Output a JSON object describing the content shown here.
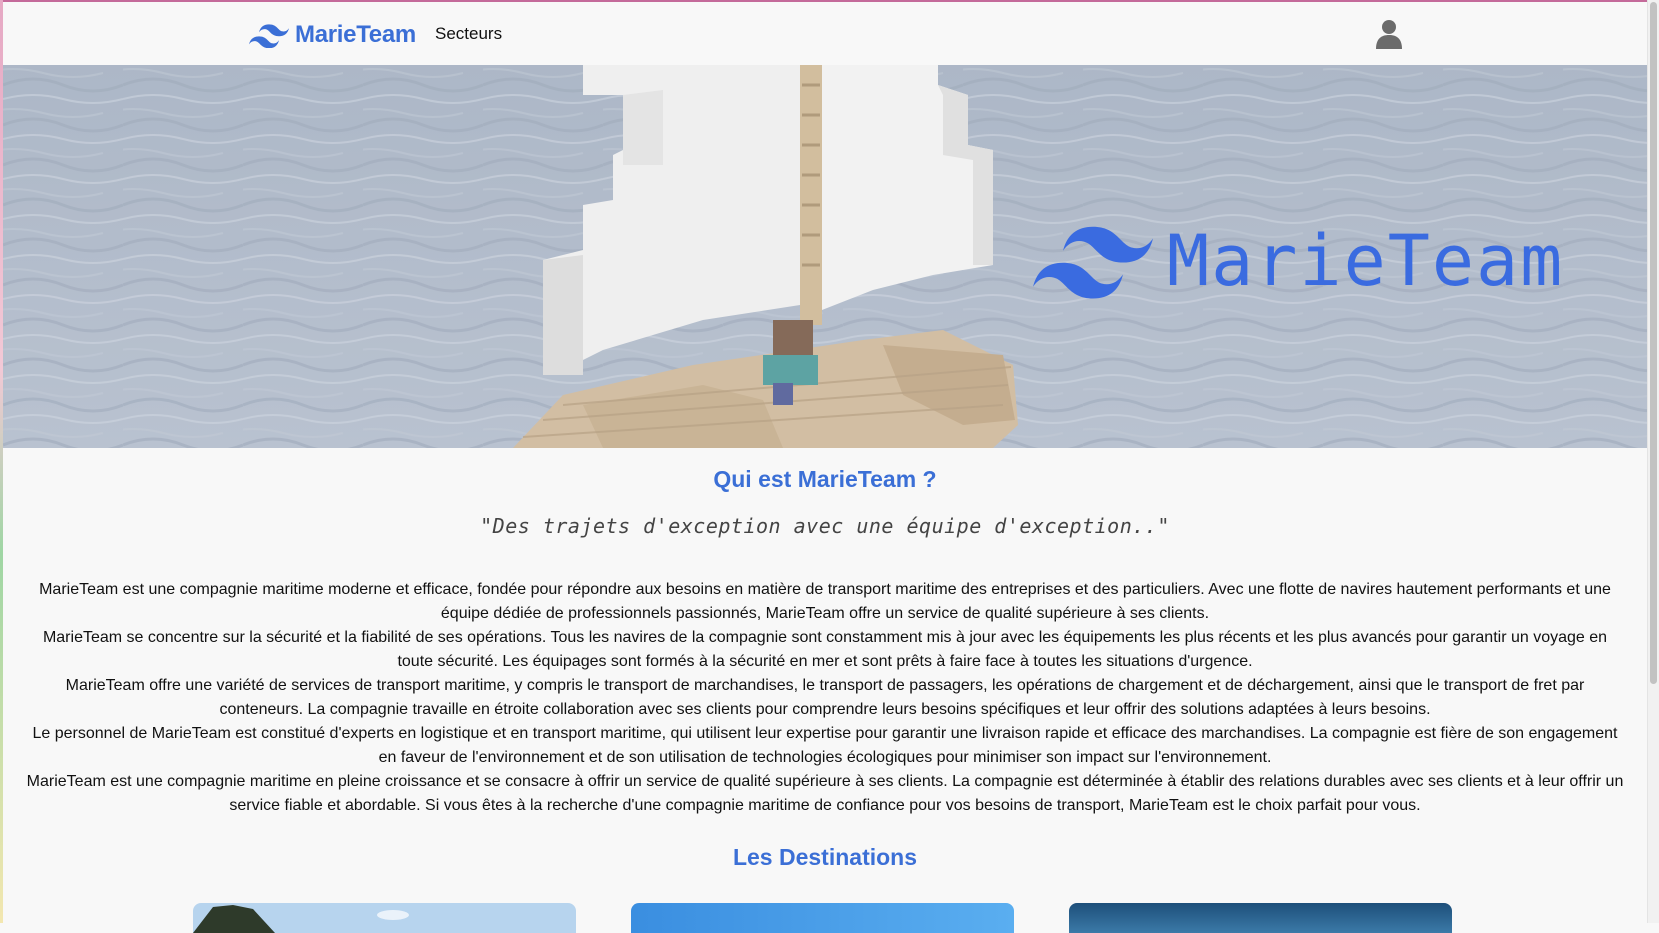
{
  "navbar": {
    "brand_name": "MarieTeam",
    "links": [
      {
        "label": "Secteurs"
      }
    ],
    "user_icon": "user-icon"
  },
  "hero": {
    "logo_text": "MarieTeam",
    "colors": {
      "brand": "#3a6be0"
    }
  },
  "about": {
    "title": "Qui est MarieTeam ?",
    "quote": "\"Des trajets d'exception avec une équipe d'exception..\"",
    "paragraphs": [
      "MarieTeam est une compagnie maritime moderne et efficace, fondée pour répondre aux besoins en matière de transport maritime des entreprises et des particuliers. Avec une flotte de navires hautement performants et une équipe dédiée de professionnels passionnés, MarieTeam offre un service de qualité supérieure à ses clients.",
      "MarieTeam se concentre sur la sécurité et la fiabilité de ses opérations. Tous les navires de la compagnie sont constamment mis à jour avec les équipements les plus récents et les plus avancés pour garantir un voyage en toute sécurité. Les équipages sont formés à la sécurité en mer et sont prêts à faire face à toutes les situations d'urgence.",
      "MarieTeam offre une variété de services de transport maritime, y compris le transport de marchandises, le transport de passagers, les opérations de chargement et de déchargement, ainsi que le transport de fret par conteneurs. La compagnie travaille en étroite collaboration avec ses clients pour comprendre leurs besoins spécifiques et leur offrir des solutions adaptées à leurs besoins.",
      "Le personnel de MarieTeam est constitué d'experts en logistique et en transport maritime, qui utilisent leur expertise pour garantir une livraison rapide et efficace des marchandises. La compagnie est fière de son engagement en faveur de l'environnement et de son utilisation de technologies écologiques pour minimiser son impact sur l'environnement.",
      "MarieTeam est une compagnie maritime en pleine croissance et se consacre à offrir un service de qualité supérieure à ses clients. La compagnie est déterminée à établir des relations durables avec ses clients et à leur offrir un service fiable et abordable. Si vous êtes à la recherche d'une compagnie maritime de confiance pour vos besoins de transport, MarieTeam est le choix parfait pour vous."
    ]
  },
  "destinations": {
    "title": "Les Destinations",
    "cards": [
      {
        "image": "destination-photo-coast-trees"
      },
      {
        "image": "destination-photo-sky"
      },
      {
        "image": "destination-photo-sea"
      }
    ]
  }
}
